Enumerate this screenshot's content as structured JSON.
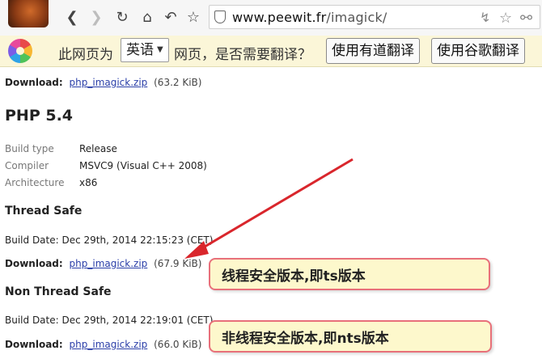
{
  "browser": {
    "url_host": "www.peewit.fr",
    "url_path": "/imagick/",
    "icons": [
      "back-icon",
      "forward-icon",
      "reload-icon",
      "home-icon",
      "undo-icon",
      "star-icon",
      "shield-icon",
      "lightning-icon"
    ]
  },
  "translate_bar": {
    "prefix": "此网页为",
    "language": "英语",
    "suffix": "网页，是否需要翻译？",
    "youdao_button": "使用有道翻译",
    "google_button": "使用谷歌翻译"
  },
  "page": {
    "download_label": "Download:",
    "top_download": {
      "file": "php_imagick.zip",
      "size": "(63.2 KiB)"
    },
    "version_heading": "PHP 5.4",
    "meta": [
      {
        "key": "Build type",
        "value": "Release"
      },
      {
        "key": "Compiler",
        "value": "MSVC9 (Visual C++ 2008)"
      },
      {
        "key": "Architecture",
        "value": "x86"
      }
    ],
    "thread_safe": {
      "heading": "Thread Safe",
      "build_date": "Build Date: Dec 29th, 2014 22:15:23 (CET)",
      "file": "php_imagick.zip",
      "size": "(67.9 KiB)"
    },
    "non_thread_safe": {
      "heading": "Non Thread Safe",
      "build_date": "Build Date: Dec 29th, 2014 22:19:01 (CET)",
      "file": "php_imagick.zip",
      "size": "(66.0 KiB)"
    }
  },
  "annotations": {
    "ts_note": "线程安全版本,即ts版本",
    "nts_note": "非线程安全版本,即nts版本",
    "arrow_color": "#d9262c"
  }
}
